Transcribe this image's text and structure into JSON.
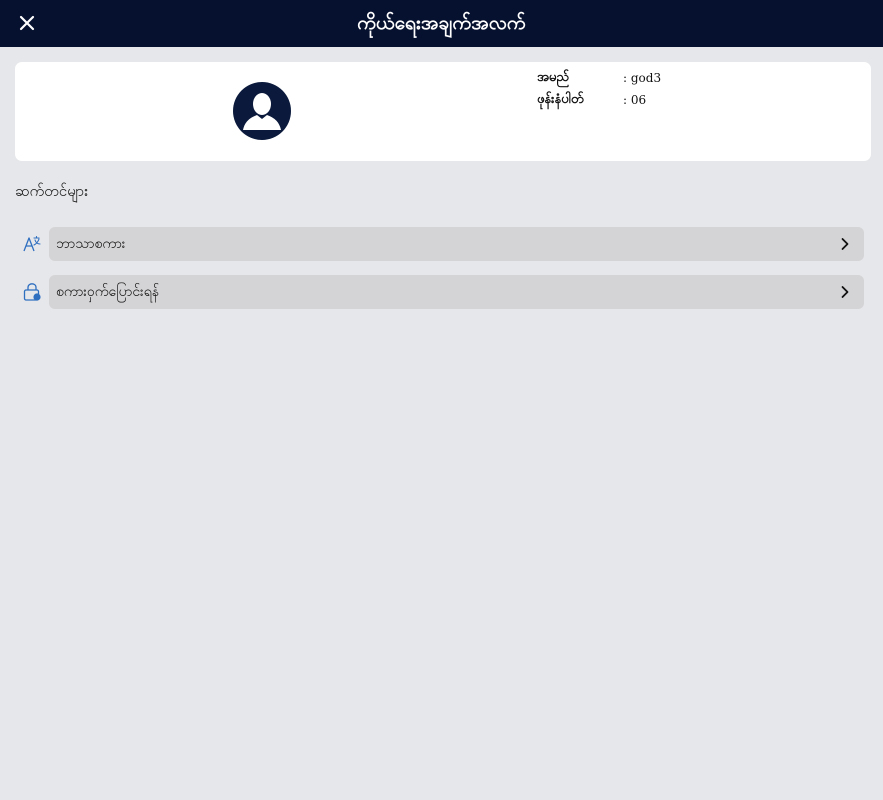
{
  "header": {
    "title": "ကိုယ်ရေးအချက်အလက်",
    "close_icon": "close-icon"
  },
  "profile": {
    "avatar_icon": "user-avatar-icon",
    "fields": [
      {
        "label": "အမည်",
        "value": ": god3"
      },
      {
        "label": "ဖုန်းနံပါတ်",
        "value": ": 06"
      }
    ]
  },
  "settings": {
    "title": "ဆက်တင်များ",
    "items": [
      {
        "label": "ဘာသာစကား",
        "icon": "language-icon"
      },
      {
        "label": "စကားဝှက်ပြောင်းရန်",
        "icon": "lock-icon"
      }
    ]
  },
  "colors": {
    "header_bg": "#06112f",
    "page_bg": "#e6e7ea",
    "row_bg": "#d4d4d6",
    "icon_accent": "#2f6fc0"
  }
}
